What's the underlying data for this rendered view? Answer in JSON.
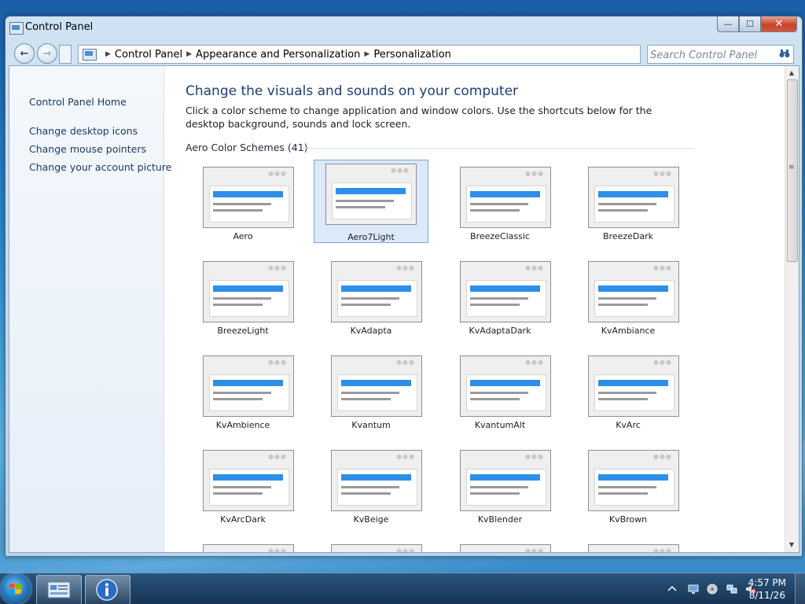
{
  "window": {
    "title": "Control Panel",
    "min_icon": "—",
    "max_icon": "☐",
    "close_icon": "✕"
  },
  "navbar": {
    "breadcrumbs": [
      "Control Panel",
      "Appearance and Personalization",
      "Personalization"
    ],
    "search_placeholder": "Search Control Panel"
  },
  "sidebar": {
    "home": "Control Panel Home",
    "links": [
      "Change desktop icons",
      "Change mouse pointers",
      "Change your account picture"
    ]
  },
  "main": {
    "heading": "Change the visuals and sounds on your computer",
    "description": "Click a color scheme to change application and window colors. Use the shortcuts below for the desktop background, sounds and lock screen.",
    "section_title": "Aero Color Schemes (41)",
    "selected_scheme": "Aero7Light",
    "schemes": [
      "Aero",
      "Aero7Light",
      "BreezeClassic",
      "BreezeDark",
      "BreezeLight",
      "KvAdapta",
      "KvAdaptaDark",
      "KvAmbiance",
      "KvAmbience",
      "Kvantum",
      "KvantumAlt",
      "KvArc",
      "KvArcDark",
      "KvBeige",
      "KvBlender",
      "KvBrown"
    ]
  },
  "colors": {
    "accent_bar": "#2d8fe8",
    "selected_bg": "#dbe9fa",
    "heading": "#1e3f6e"
  },
  "taskbar": {
    "time": "4:57 PM",
    "date": "8/11/26",
    "tray_icons": [
      "chevron-up-icon",
      "monitor-icon",
      "disc-icon",
      "network-icon",
      "volume-muted-icon"
    ]
  }
}
